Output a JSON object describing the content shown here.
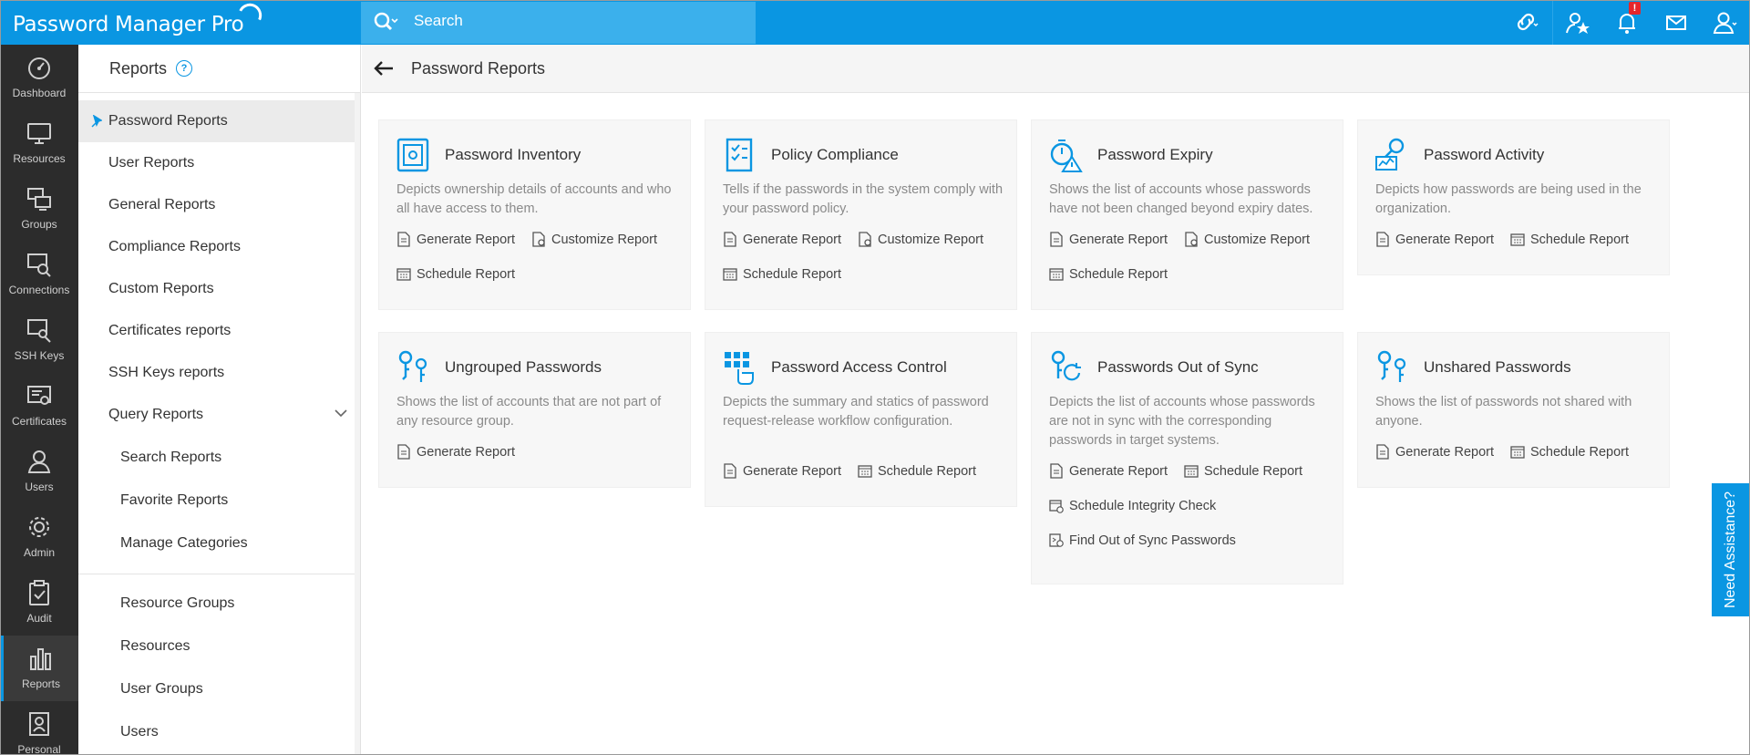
{
  "app": {
    "title": "Password Manager Pro",
    "brand_color": "#0a96e2"
  },
  "search": {
    "placeholder": "Search"
  },
  "topbar": {
    "icons": [
      "link-icon",
      "star-user-icon",
      "bell-icon",
      "mail-icon",
      "user-icon"
    ],
    "alert_badge": "!"
  },
  "rail": {
    "items": [
      {
        "label": "Dashboard",
        "icon": "gauge-icon"
      },
      {
        "label": "Resources",
        "icon": "monitor-icon"
      },
      {
        "label": "Groups",
        "icon": "groups-icon"
      },
      {
        "label": "Connections",
        "icon": "connections-icon"
      },
      {
        "label": "SSH Keys",
        "icon": "ssh-key-icon"
      },
      {
        "label": "Certificates",
        "icon": "certificate-icon"
      },
      {
        "label": "Users",
        "icon": "user-icon"
      },
      {
        "label": "Admin",
        "icon": "gear-icon"
      },
      {
        "label": "Audit",
        "icon": "clipboard-icon"
      },
      {
        "label": "Reports",
        "icon": "bar-chart-icon",
        "active": true
      },
      {
        "label": "Personal",
        "icon": "contact-card-icon"
      }
    ]
  },
  "subnav": {
    "title": "Reports",
    "help": "?",
    "items": [
      {
        "label": "Password Reports",
        "active": true
      },
      {
        "label": "User Reports"
      },
      {
        "label": "General Reports"
      },
      {
        "label": "Compliance Reports"
      },
      {
        "label": "Custom Reports"
      },
      {
        "label": "Certificates reports"
      },
      {
        "label": "SSH Keys reports"
      },
      {
        "label": "Query Reports"
      }
    ],
    "query_children": [
      "Search Reports",
      "Favorite Reports",
      "Manage Categories"
    ],
    "lower_items": [
      "Resource Groups",
      "Resources",
      "User Groups",
      "Users"
    ]
  },
  "content": {
    "title": "Password Reports",
    "cards": [
      {
        "title": "Password Inventory",
        "icon": "safe-icon",
        "desc": "Depicts ownership details of accounts and who all have access to them.",
        "actions": [
          "Generate Report",
          "Customize Report",
          "Schedule Report"
        ]
      },
      {
        "title": "Policy Compliance",
        "icon": "checklist-icon",
        "desc": "Tells if the passwords in the system comply with your password policy.",
        "actions": [
          "Generate Report",
          "Customize Report",
          "Schedule Report"
        ]
      },
      {
        "title": "Password Expiry",
        "icon": "timer-warning-icon",
        "desc": "Shows the list of accounts whose passwords have not been changed beyond expiry dates.",
        "actions": [
          "Generate Report",
          "Customize Report",
          "Schedule Report"
        ]
      },
      {
        "title": "Password Activity",
        "icon": "key-activity-icon",
        "desc": "Depicts how passwords are being used in the organization.",
        "actions": [
          "Generate Report",
          "Schedule Report"
        ]
      },
      {
        "title": "Ungrouped Passwords",
        "icon": "keys-icon",
        "desc": "Shows the list of accounts that are not part of any resource group.",
        "actions": [
          "Generate Report"
        ]
      },
      {
        "title": "Password Access Control",
        "icon": "access-grid-icon",
        "desc": "Depicts the summary and statics of password request-release workflow configuration.",
        "actions": [
          "Generate Report",
          "Schedule Report"
        ]
      },
      {
        "title": "Passwords Out of Sync",
        "icon": "key-sync-icon",
        "desc": "Depicts the list of accounts whose passwords are not in sync with the corresponding passwords in target systems.",
        "actions": [
          "Generate Report",
          "Schedule Report",
          "Schedule Integrity Check",
          "Find Out of Sync Passwords"
        ]
      },
      {
        "title": "Unshared Passwords",
        "icon": "keys-icon",
        "desc": "Shows the list of passwords not shared with anyone.",
        "actions": [
          "Generate Report",
          "Schedule Report"
        ]
      }
    ]
  },
  "assist": {
    "label": "Need Assistance?"
  }
}
